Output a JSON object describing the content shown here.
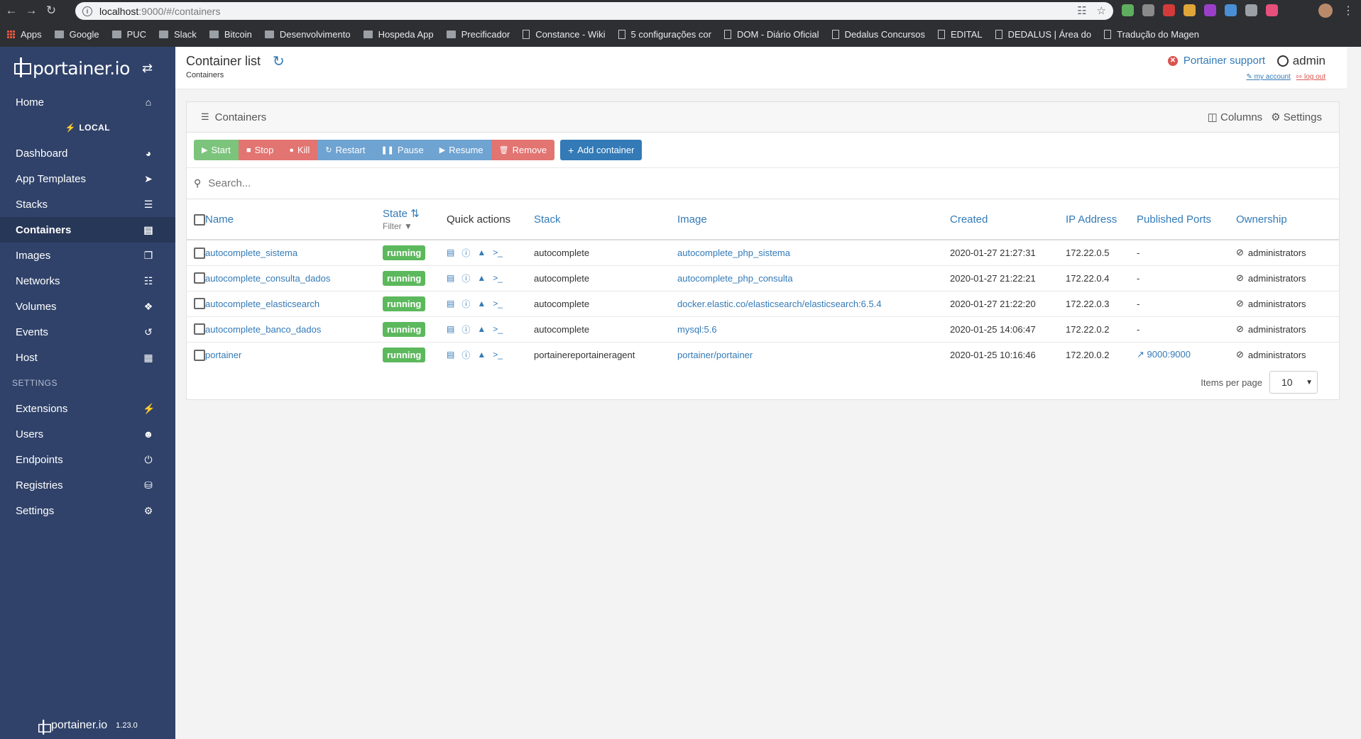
{
  "browser": {
    "url_host": "localhost",
    "url_path": ":9000/#/containers",
    "bookmarks": [
      {
        "label": "Apps"
      },
      {
        "label": "Google"
      },
      {
        "label": "PUC"
      },
      {
        "label": "Slack"
      },
      {
        "label": "Bitcoin"
      },
      {
        "label": "Desenvolvimento"
      },
      {
        "label": "Hospeda App"
      },
      {
        "label": "Precificador"
      },
      {
        "label": "Constance - Wiki"
      },
      {
        "label": "5 configurações cor"
      },
      {
        "label": "DOM - Diário Oficial"
      },
      {
        "label": "Dedalus Concursos"
      },
      {
        "label": "EDITAL"
      },
      {
        "label": "DEDALUS | Área do"
      },
      {
        "label": "Tradução do Magen"
      }
    ]
  },
  "sidebar": {
    "logo_text": "portainer.io",
    "home": "Home",
    "endpoint_label": "LOCAL",
    "items": [
      {
        "label": "Dashboard",
        "icon": "tachometer-icon"
      },
      {
        "label": "App Templates",
        "icon": "rocket-icon"
      },
      {
        "label": "Stacks",
        "icon": "th-list-icon"
      },
      {
        "label": "Containers",
        "icon": "server-icon"
      },
      {
        "label": "Images",
        "icon": "clone-icon"
      },
      {
        "label": "Networks",
        "icon": "sitemap-icon"
      },
      {
        "label": "Volumes",
        "icon": "cubes-icon"
      },
      {
        "label": "Events",
        "icon": "history-icon"
      },
      {
        "label": "Host",
        "icon": "th-icon"
      }
    ],
    "settings_label": "SETTINGS",
    "settings_items": [
      {
        "label": "Extensions",
        "icon": "bolt-icon"
      },
      {
        "label": "Users",
        "icon": "users-icon"
      },
      {
        "label": "Endpoints",
        "icon": "plug-icon"
      },
      {
        "label": "Registries",
        "icon": "database-icon"
      },
      {
        "label": "Settings",
        "icon": "cogs-icon"
      }
    ],
    "footer_logo": "portainer.io",
    "version": "1.23.0"
  },
  "header": {
    "title": "Container list",
    "breadcrumb": "Containers",
    "support": "Portainer support",
    "user": "admin",
    "my_account": "my account",
    "log_out": "log out"
  },
  "widget": {
    "title": "Containers",
    "columns_label": "Columns",
    "settings_label": "Settings",
    "buttons": {
      "start": "Start",
      "stop": "Stop",
      "kill": "Kill",
      "restart": "Restart",
      "pause": "Pause",
      "resume": "Resume",
      "remove": "Remove",
      "add": "Add container"
    },
    "search_placeholder": "Search...",
    "columns": {
      "name": "Name",
      "state": "State",
      "state_filter": "Filter",
      "quick_actions": "Quick actions",
      "stack": "Stack",
      "image": "Image",
      "created": "Created",
      "ip": "IP Address",
      "ports": "Published Ports",
      "ownership": "Ownership"
    },
    "rows": [
      {
        "name": "autocomplete_sistema",
        "state": "running",
        "stack": "autocomplete",
        "image": "autocomplete_php_sistema",
        "created": "2020-01-27 21:27:31",
        "ip": "172.22.0.5",
        "ports": "-",
        "ownership": "administrators"
      },
      {
        "name": "autocomplete_consulta_dados",
        "state": "running",
        "stack": "autocomplete",
        "image": "autocomplete_php_consulta",
        "created": "2020-01-27 21:22:21",
        "ip": "172.22.0.4",
        "ports": "-",
        "ownership": "administrators"
      },
      {
        "name": "autocomplete_elasticsearch",
        "state": "running",
        "stack": "autocomplete",
        "image": "docker.elastic.co/elasticsearch/elasticsearch:6.5.4",
        "created": "2020-01-27 21:22:20",
        "ip": "172.22.0.3",
        "ports": "-",
        "ownership": "administrators"
      },
      {
        "name": "autocomplete_banco_dados",
        "state": "running",
        "stack": "autocomplete",
        "image": "mysql:5.6",
        "created": "2020-01-25 14:06:47",
        "ip": "172.22.0.2",
        "ports": "-",
        "ownership": "administrators"
      },
      {
        "name": "portainer",
        "state": "running",
        "stack": "portainereportaineragent",
        "image": "portainer/portainer",
        "created": "2020-01-25 10:16:46",
        "ip": "172.20.0.2",
        "ports": "9000:9000",
        "ownership": "administrators"
      }
    ],
    "items_per_page_label": "Items per page",
    "items_per_page": "10"
  }
}
